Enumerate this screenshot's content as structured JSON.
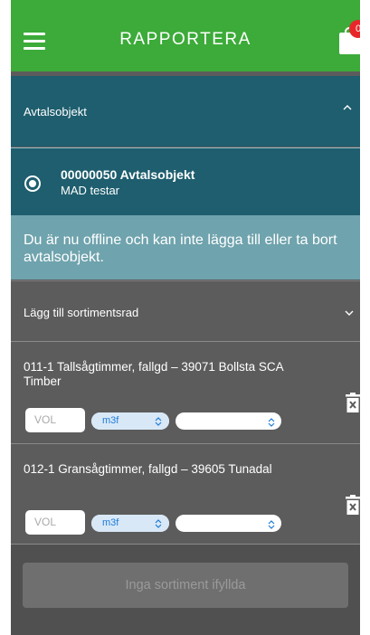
{
  "header": {
    "title": "RAPPORTERA",
    "cart_count": "0",
    "accent": "#3cab39",
    "badge_color": "#e8272a"
  },
  "agreement_section": {
    "label": "Avtalsobjekt",
    "expanded": true,
    "selected_object": {
      "title": "00000050 Avtalsobjekt",
      "subtitle": "MAD testar"
    }
  },
  "offline_notice": "Du är nu offline och kan inte lägga till eller ta bort avtalsobjekt.",
  "assortment_section": {
    "label": "Lägg till sortimentsrad",
    "expanded": false
  },
  "rows": [
    {
      "text": "011-1 Tallsågtimmer, fallgd – 39071 Bollsta SCA Timber",
      "volume_placeholder": "VOL",
      "unit": "m3f",
      "second_select": ""
    },
    {
      "text": "012-1 Gransågtimmer, fallgd – 39605 Tunadal",
      "volume_placeholder": "VOL",
      "unit": "m3f",
      "second_select": ""
    }
  ],
  "submit_button": "Inga sortiment ifyllda",
  "icons": [
    "menu-icon",
    "cart-icon",
    "chevron-up-icon",
    "chevron-down-icon",
    "radio-selected-icon",
    "trash-icon",
    "select-updown-icon"
  ]
}
